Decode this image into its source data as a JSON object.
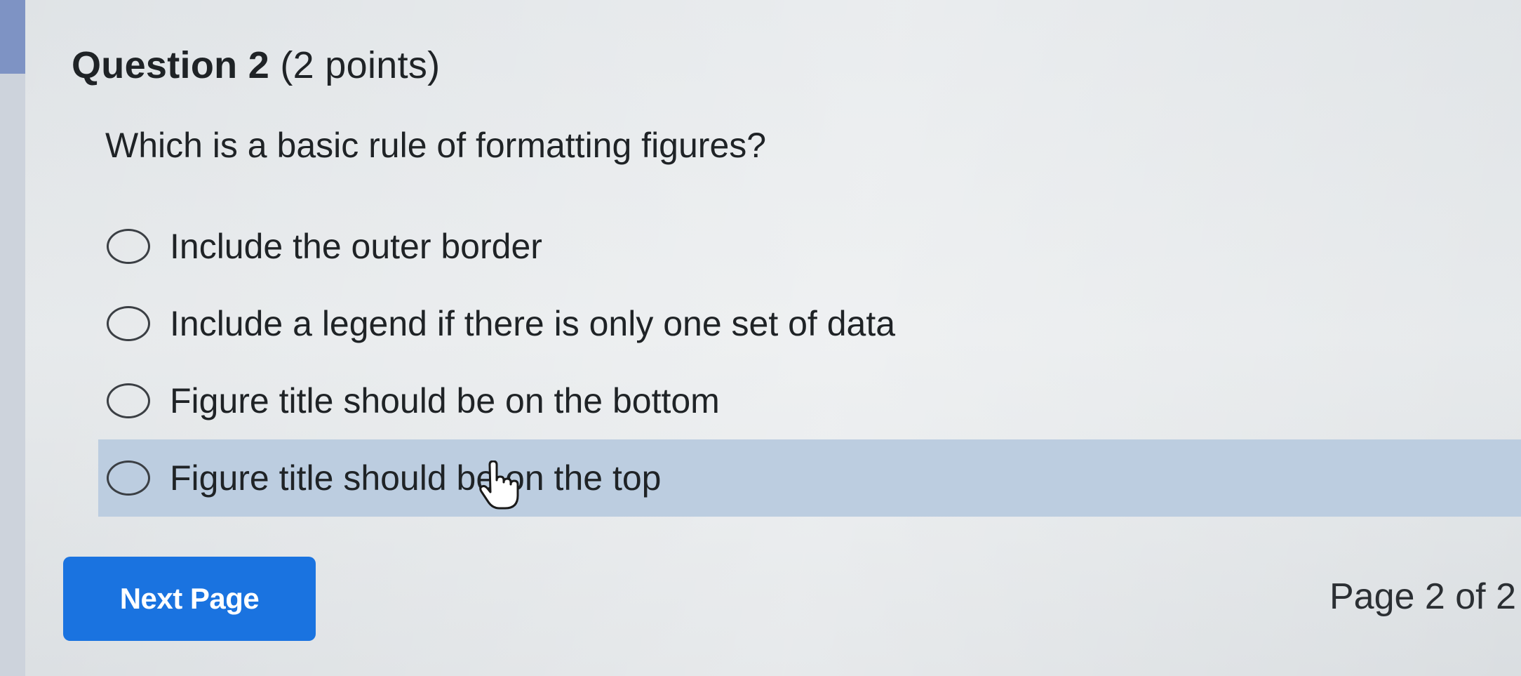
{
  "question": {
    "title": "Question 2",
    "points": "(2 points)",
    "prompt": "Which is a basic rule of formatting figures?"
  },
  "options": [
    {
      "label": "Include the outer border",
      "selected": false
    },
    {
      "label": "Include a legend if there is only one set of data",
      "selected": false
    },
    {
      "label": "Figure title should be on the bottom",
      "selected": false
    },
    {
      "label": "Figure title should be on the top",
      "selected": false,
      "hovered": true
    }
  ],
  "footer": {
    "next_label": "Next Page",
    "page_indicator": "Page 2 of 2"
  },
  "colors": {
    "button_bg": "#1a73e0",
    "hover_row": "#bccde0",
    "accent": "#7e93c4"
  }
}
